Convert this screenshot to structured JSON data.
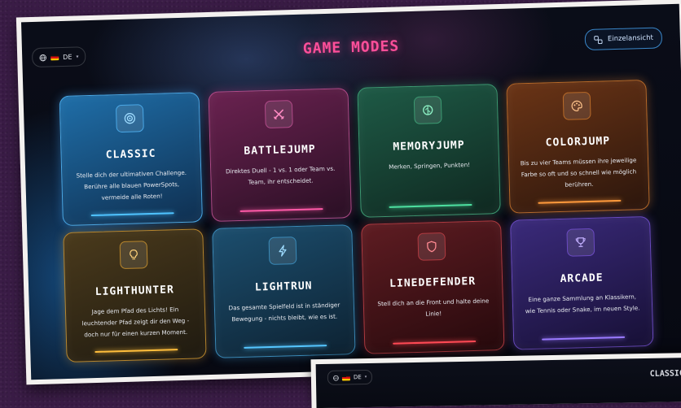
{
  "header": {
    "title": "GAME MODES",
    "language": "DE",
    "language_caret": "▾",
    "view_button": "Einzelansicht"
  },
  "modes": [
    {
      "title": "CLASSIC",
      "description": "Stelle dich der ultimativen Challenge. Berühre alle blauen PowerSpots, vermeide alle Roten!",
      "icon": "target-icon",
      "accent": "#4fc3ff"
    },
    {
      "title": "BATTLEJUMP",
      "description": "Direktes Duell - 1 vs. 1 oder Team vs. Team, ihr entscheidet.",
      "icon": "crossed-swords-icon",
      "accent": "#ff5aa8"
    },
    {
      "title": "MEMORYJUMP",
      "description": "Merken, Springen, Punkten!",
      "icon": "brain-icon",
      "accent": "#4de0a0"
    },
    {
      "title": "COLORJUMP",
      "description": "Bis zu vier Teams müssen ihre jeweilige Farbe so oft und so schnell wie möglich berühren.",
      "icon": "palette-icon",
      "accent": "#ff9a3c"
    },
    {
      "title": "LIGHTHUNTER",
      "description": "Jage dem Pfad des Lichts! Ein leuchtender Pfad zeigt dir den Weg - doch nur für einen kurzen Moment.",
      "icon": "lightbulb-icon",
      "accent": "#ffbe3c"
    },
    {
      "title": "LIGHTRUN",
      "description": "Das gesamte Spielfeld ist in ständiger Bewegung - nichts bleibt, wie es ist.",
      "icon": "lightning-icon",
      "accent": "#55c6ff"
    },
    {
      "title": "LINEDEFENDER",
      "description": "Stell dich an die Front und halte deine Linie!",
      "icon": "shield-icon",
      "accent": "#ff4a55"
    },
    {
      "title": "ARCADE",
      "description": "Eine ganze Sammlung an Klassikern, wie Tennis oder Snake, im neuen Style.",
      "icon": "trophy-icon",
      "accent": "#9a7aff"
    }
  ],
  "second_screen": {
    "language": "DE",
    "language_caret": "▾",
    "peek_title": "CLASSIC"
  }
}
